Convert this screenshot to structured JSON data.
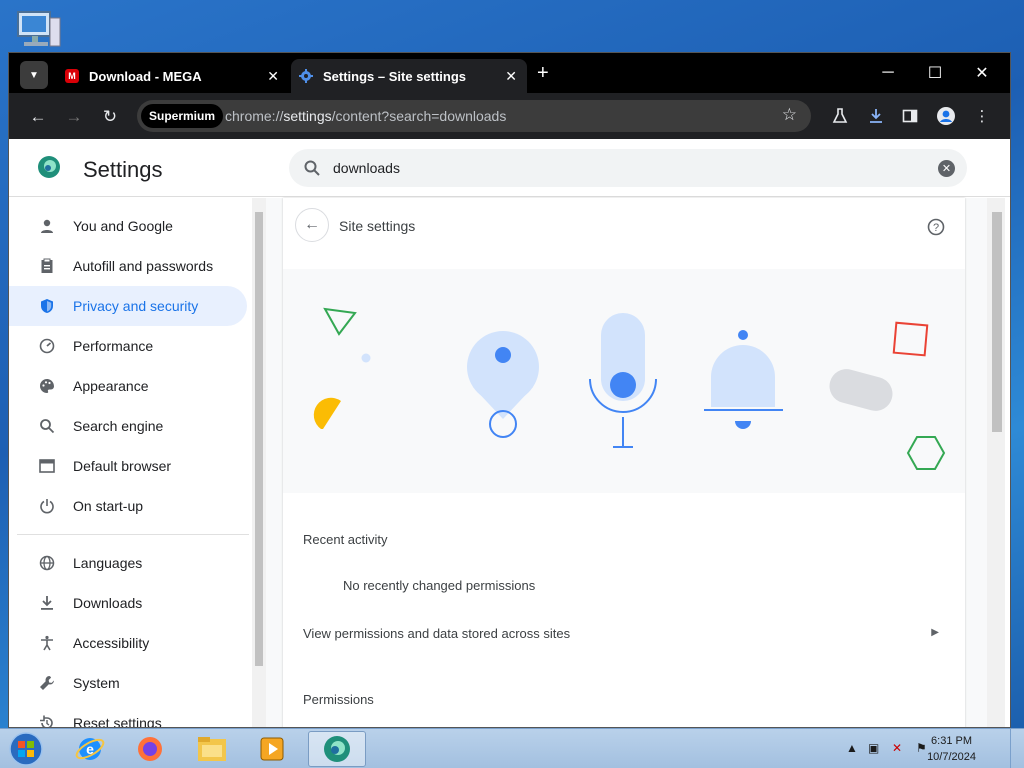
{
  "tabs": [
    {
      "title": "Download - MEGA",
      "favicon": "mega-icon",
      "favicon_color": "#d90007"
    },
    {
      "title": "Settings – Site settings",
      "favicon": "gear-icon",
      "favicon_color": "#8ab4f8"
    }
  ],
  "address_bar": {
    "chip": "Supermium",
    "url_prefix": "chrome://",
    "url_host": "settings",
    "url_path": "/content?search=downloads"
  },
  "settings": {
    "title": "Settings",
    "search_value": "downloads"
  },
  "sidebar": {
    "items": [
      {
        "label": "You and Google",
        "icon": "person-icon"
      },
      {
        "label": "Autofill and passwords",
        "icon": "clipboard-icon"
      },
      {
        "label": "Privacy and security",
        "icon": "shield-icon",
        "active": true
      },
      {
        "label": "Performance",
        "icon": "gauge-icon"
      },
      {
        "label": "Appearance",
        "icon": "palette-icon"
      },
      {
        "label": "Search engine",
        "icon": "search-icon"
      },
      {
        "label": "Default browser",
        "icon": "browser-icon"
      },
      {
        "label": "On start-up",
        "icon": "power-icon"
      },
      {
        "label": "Languages",
        "icon": "globe-icon"
      },
      {
        "label": "Downloads",
        "icon": "download-icon"
      },
      {
        "label": "Accessibility",
        "icon": "accessibility-icon"
      },
      {
        "label": "System",
        "icon": "wrench-icon"
      },
      {
        "label": "Reset settings",
        "icon": "reset-icon"
      }
    ]
  },
  "site_settings": {
    "title": "Site settings",
    "recent_activity_heading": "Recent activity",
    "no_recent": "No recently changed permissions",
    "view_permissions": "View permissions and data stored across sites",
    "permissions_heading": "Permissions"
  },
  "taskbar": {
    "time": "6:31 PM",
    "date": "10/7/2024"
  },
  "colors": {
    "accent": "#1a73e8",
    "active_nav_bg": "#e8f0fe",
    "titlebar": "#000000",
    "toolbar": "#202124"
  }
}
